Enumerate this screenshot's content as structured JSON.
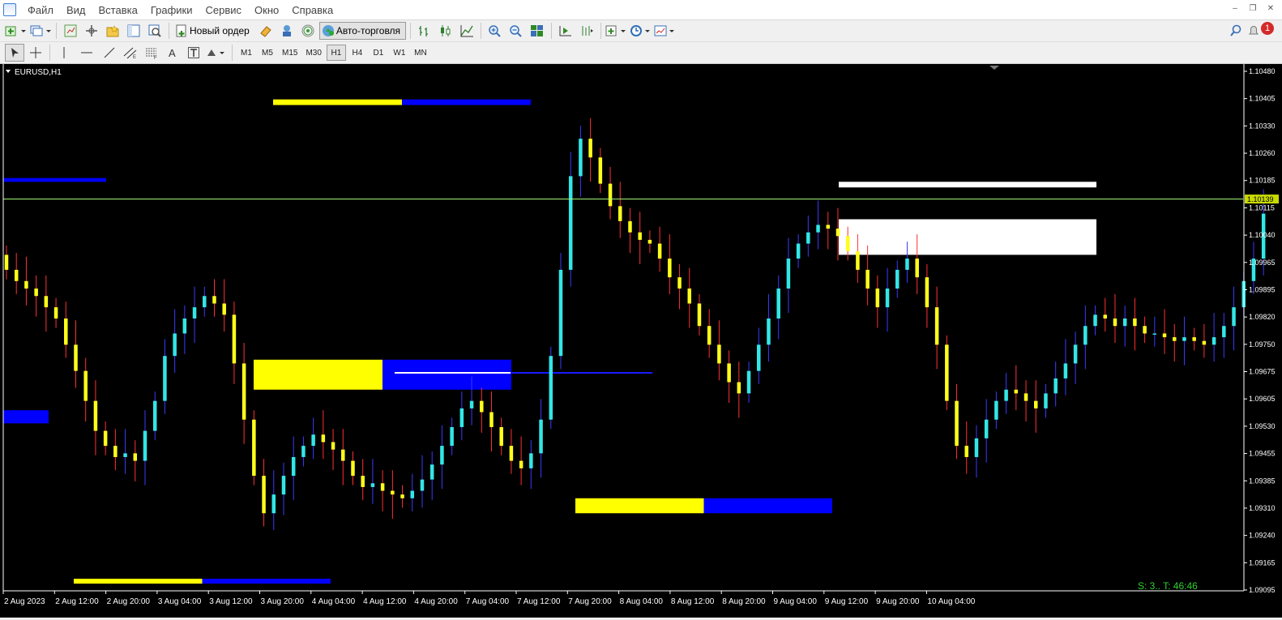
{
  "menu": {
    "items": [
      "Файл",
      "Вид",
      "Вставка",
      "Графики",
      "Сервис",
      "Окно",
      "Справка"
    ]
  },
  "toolbar": {
    "new_order_label": "Новый ордер",
    "auto_trading_label": "Авто-торговля",
    "alert_count": "1"
  },
  "timeframes": [
    "M1",
    "M5",
    "M15",
    "M30",
    "H1",
    "H4",
    "D1",
    "W1",
    "MN"
  ],
  "active_timeframe": "H1",
  "chart": {
    "symbol_label": "EURUSD,H1",
    "current_price_label": "1.10139",
    "status_text": "S: 3.. T: 46:46",
    "price_labels": [
      "1.10480",
      "1.10405",
      "1.10330",
      "1.10260",
      "1.10185",
      "1.10115",
      "1.10040",
      "1.09965",
      "1.09895",
      "1.09820",
      "1.09750",
      "1.09675",
      "1.09605",
      "1.09530",
      "1.09455",
      "1.09385",
      "1.09310",
      "1.09240",
      "1.09165",
      "1.09095"
    ],
    "time_labels": [
      "2 Aug 2023",
      "2 Aug 12:00",
      "2 Aug 20:00",
      "3 Aug 04:00",
      "3 Aug 12:00",
      "3 Aug 20:00",
      "4 Aug 04:00",
      "4 Aug 12:00",
      "4 Aug 20:00",
      "7 Aug 04:00",
      "7 Aug 12:00",
      "7 Aug 20:00",
      "8 Aug 04:00",
      "8 Aug 12:00",
      "8 Aug 20:00",
      "9 Aug 04:00",
      "9 Aug 12:00",
      "9 Aug 20:00",
      "10 Aug 04:00"
    ],
    "colors": {
      "background": "#000000",
      "bull": "#33e6e6",
      "bear": "#ffff1a",
      "zone_yellow": "#ffff00",
      "zone_blue": "#0000ff",
      "bid_line": "#a8ff7a",
      "zone_white": "#ffffff"
    }
  },
  "chart_data": {
    "type": "candlestick",
    "symbol": "EURUSD",
    "timeframe": "H1",
    "ylim": [
      1.09095,
      1.1048
    ],
    "current_bid": 1.10139,
    "x_range": [
      "2 Aug 2023",
      "10 Aug 2023 ~08:00"
    ],
    "closes": [
      1.0995,
      1.0992,
      1.099,
      1.0988,
      1.0985,
      1.0982,
      1.0975,
      1.0968,
      1.096,
      1.0952,
      1.0948,
      1.0945,
      1.0946,
      1.0944,
      1.0952,
      1.096,
      1.0972,
      1.0978,
      1.0982,
      1.0985,
      1.0988,
      1.0986,
      1.0983,
      1.097,
      1.0955,
      1.094,
      1.093,
      1.0935,
      1.094,
      1.0945,
      1.0948,
      1.0951,
      1.0949,
      1.0947,
      1.0944,
      1.094,
      1.0937,
      1.0938,
      1.0936,
      1.0935,
      1.0934,
      1.0936,
      1.0939,
      1.0943,
      1.0948,
      1.0953,
      1.0958,
      1.096,
      1.0957,
      1.0953,
      1.0948,
      1.0944,
      1.0942,
      1.0946,
      1.0955,
      1.0972,
      1.0995,
      1.102,
      1.103,
      1.1025,
      1.1018,
      1.1012,
      1.1008,
      1.1005,
      1.1003,
      1.1002,
      1.0998,
      1.0993,
      1.099,
      1.0986,
      1.098,
      1.0975,
      1.097,
      1.0965,
      1.0962,
      1.0968,
      1.0975,
      1.0982,
      1.099,
      1.0998,
      1.1002,
      1.1005,
      1.1007,
      1.1006,
      1.1004,
      1.1,
      1.0995,
      1.099,
      1.0985,
      1.099,
      1.0995,
      1.0998,
      1.0993,
      1.0985,
      1.0975,
      1.096,
      1.0948,
      1.0945,
      1.095,
      1.0955,
      1.096,
      1.0963,
      1.0962,
      1.096,
      1.0958,
      1.0962,
      1.0966,
      1.097,
      1.0975,
      1.098,
      1.0983,
      1.0982,
      1.098,
      1.0982,
      1.098,
      1.0978,
      1.0978,
      1.0977,
      1.0976,
      1.0977,
      1.0976,
      1.0975,
      1.0977,
      1.098,
      1.0985,
      1.0992,
      1.0998,
      1.101
    ],
    "zones": [
      {
        "color": "yellow+blue",
        "price_top": 1.10405,
        "price_bottom": 1.1039,
        "period": "4 Aug 04:00 – 7 Aug 04:00"
      },
      {
        "color": "blue",
        "price_top": 1.10195,
        "price_bottom": 1.10185,
        "period": "2 Aug early"
      },
      {
        "color": "yellow+blue",
        "price_top": 1.0971,
        "price_bottom": 1.0963,
        "period": "3 Aug 20:00 – 7 Aug 12:00"
      },
      {
        "color": "blue",
        "price_top": 1.09575,
        "price_bottom": 1.0954,
        "period": "2 Aug early"
      },
      {
        "color": "yellow+blue",
        "price_top": 1.0934,
        "price_bottom": 1.093,
        "period": "7 Aug 20:00 – 9 Aug 04:00"
      },
      {
        "color": "yellow+blue",
        "price_top": 1.09125,
        "price_bottom": 1.09112,
        "period": "2 Aug 12:00 – 4 Aug 04:00"
      },
      {
        "color": "white",
        "price_top": 1.10185,
        "price_bottom": 1.1017,
        "period": "9 Aug 12:00 – 10 Aug 12:00"
      },
      {
        "color": "white",
        "price_top": 1.10085,
        "price_bottom": 1.0999,
        "period": "9 Aug 12:00 – 10 Aug 12:00"
      }
    ]
  }
}
